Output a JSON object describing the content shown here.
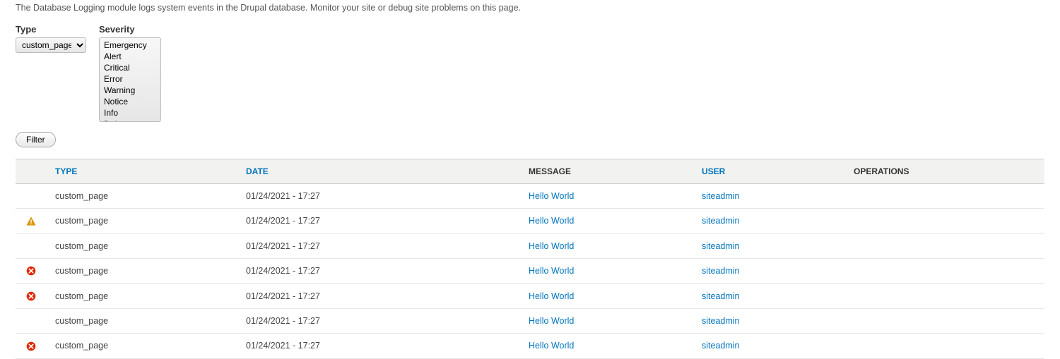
{
  "description": "The Database Logging module logs system events in the Drupal database. Monitor your site or debug site problems on this page.",
  "filters": {
    "type": {
      "label": "Type",
      "selected": "custom_page",
      "options": [
        "custom_page"
      ]
    },
    "severity": {
      "label": "Severity",
      "options": [
        "Emergency",
        "Alert",
        "Critical",
        "Error",
        "Warning",
        "Notice",
        "Info",
        "Debug"
      ]
    },
    "filter_button": "Filter"
  },
  "table": {
    "headers": {
      "type": "TYPE",
      "date": "DATE",
      "message": "MESSAGE",
      "user": "USER",
      "operations": "OPERATIONS"
    },
    "rows": [
      {
        "severity": "",
        "type": "custom_page",
        "date": "01/24/2021 - 17:27",
        "message": "Hello World",
        "user": "siteadmin",
        "operations": ""
      },
      {
        "severity": "warning",
        "type": "custom_page",
        "date": "01/24/2021 - 17:27",
        "message": "Hello World",
        "user": "siteadmin",
        "operations": ""
      },
      {
        "severity": "",
        "type": "custom_page",
        "date": "01/24/2021 - 17:27",
        "message": "Hello World",
        "user": "siteadmin",
        "operations": ""
      },
      {
        "severity": "error",
        "type": "custom_page",
        "date": "01/24/2021 - 17:27",
        "message": "Hello World",
        "user": "siteadmin",
        "operations": ""
      },
      {
        "severity": "error",
        "type": "custom_page",
        "date": "01/24/2021 - 17:27",
        "message": "Hello World",
        "user": "siteadmin",
        "operations": ""
      },
      {
        "severity": "",
        "type": "custom_page",
        "date": "01/24/2021 - 17:27",
        "message": "Hello World",
        "user": "siteadmin",
        "operations": ""
      },
      {
        "severity": "error",
        "type": "custom_page",
        "date": "01/24/2021 - 17:27",
        "message": "Hello World",
        "user": "siteadmin",
        "operations": ""
      }
    ]
  }
}
